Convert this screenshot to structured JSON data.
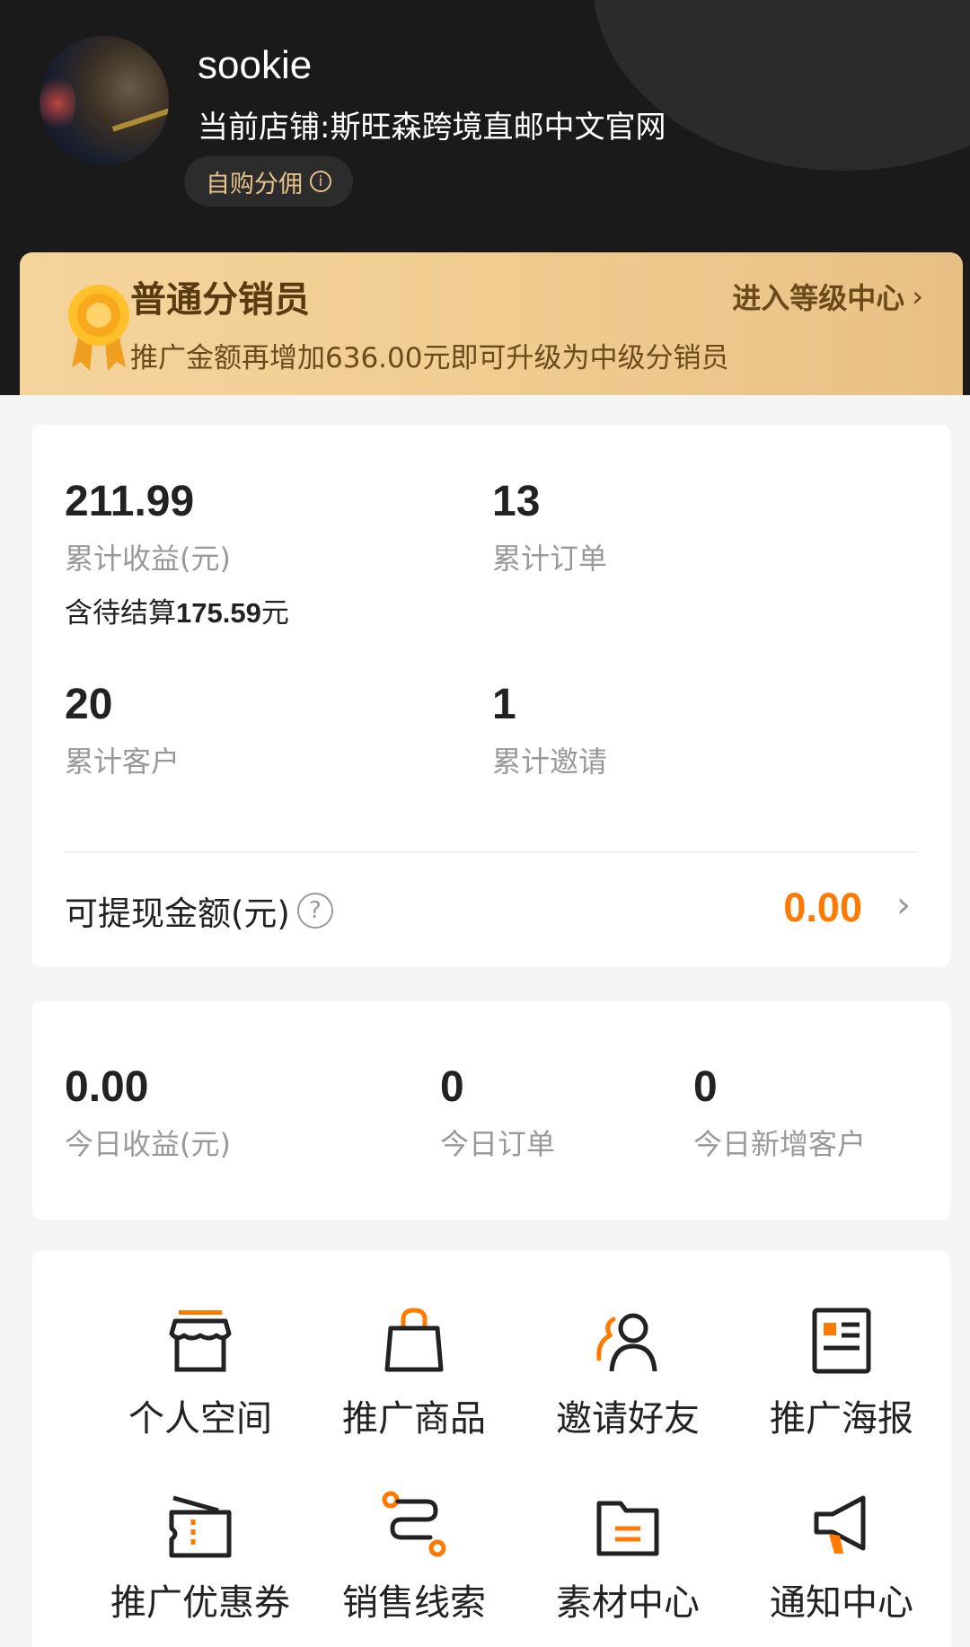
{
  "header": {
    "username": "sookie",
    "store": "当前店铺:斯旺森跨境直邮中文官网",
    "pill_label": "自购分佣",
    "pill_icon": "info-icon"
  },
  "level": {
    "title": "普通分销员",
    "link_label": "进入等级中心",
    "subtitle": "推广金额再增加636.00元即可升级为中级分销员",
    "icon": "medal-icon"
  },
  "stats": {
    "earnings_value": "211.99",
    "earnings_label": "累计收益(元)",
    "pending_prefix": "含待结算",
    "pending_value": "175.59",
    "pending_suffix": "元",
    "orders_value": "13",
    "orders_label": "累计订单",
    "customers_value": "20",
    "customers_label": "累计客户",
    "invites_value": "1",
    "invites_label": "累计邀请",
    "withdraw_label": "可提现金额(元)",
    "withdraw_value": "0.00"
  },
  "today": {
    "earnings_value": "0.00",
    "earnings_label": "今日收益(元)",
    "orders_value": "0",
    "orders_label": "今日订单",
    "new_customers_value": "0",
    "new_customers_label": "今日新增客户"
  },
  "menu": {
    "items": [
      {
        "label": "个人空间",
        "icon": "store-icon"
      },
      {
        "label": "推广商品",
        "icon": "shopping-bag-icon"
      },
      {
        "label": "邀请好友",
        "icon": "invite-friends-icon"
      },
      {
        "label": "推广海报",
        "icon": "poster-icon"
      },
      {
        "label": "推广优惠券",
        "icon": "coupon-icon"
      },
      {
        "label": "销售线索",
        "icon": "sales-leads-icon"
      },
      {
        "label": "素材中心",
        "icon": "folder-icon"
      },
      {
        "label": "通知中心",
        "icon": "megaphone-icon"
      }
    ]
  },
  "colors": {
    "accent": "#ff7a00",
    "header_bg": "#1a1a1a",
    "gold": "#e6c28a"
  }
}
